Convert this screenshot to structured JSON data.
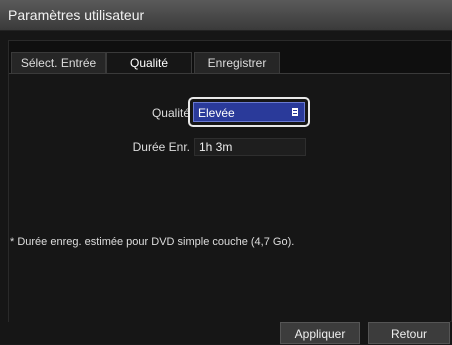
{
  "window": {
    "title": "Paramètres utilisateur"
  },
  "tabs": [
    {
      "label": "Sélect. Entrée"
    },
    {
      "label": "Qualité"
    },
    {
      "label": "Enregistrer"
    }
  ],
  "quality": {
    "label": "Qualité",
    "value": "Elevée",
    "icon": "list-icon"
  },
  "duration": {
    "label": "Durée Enr.",
    "value": "1h 3m"
  },
  "note": "* Durée enreg. estimée pour DVD simple couche (4,7 Go).",
  "buttons": {
    "apply": "Appliquer",
    "back": "Retour"
  },
  "colors": {
    "accent": "#2a3a9a",
    "background": "#161616",
    "titlebar": "#4a4a4a"
  }
}
